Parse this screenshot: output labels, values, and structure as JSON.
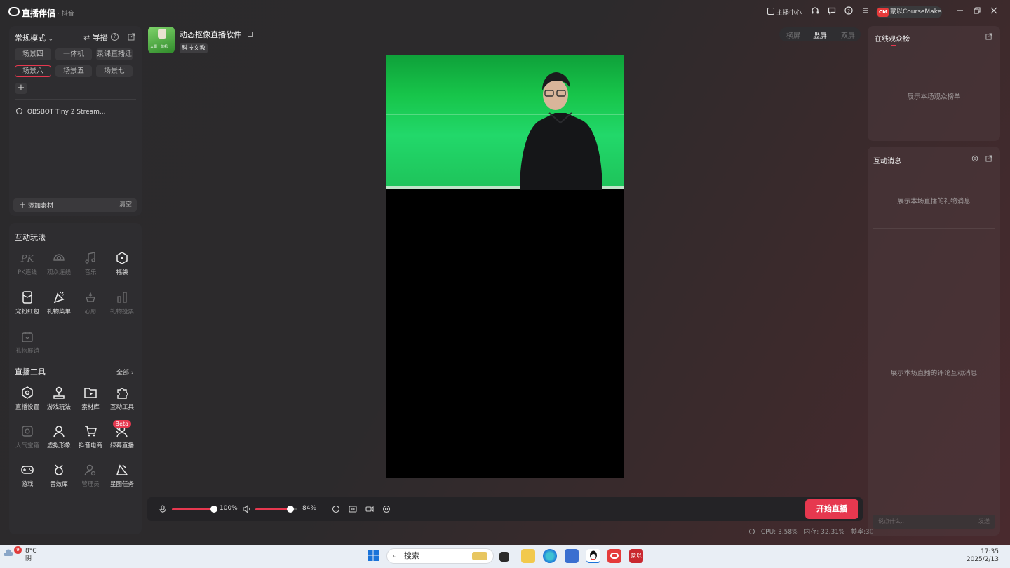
{
  "titlebar": {
    "app_name": "直播伴侣",
    "app_sub": "· 抖音",
    "host_center": "主播中心",
    "user_initials": "CM",
    "user_name": "蒙以CourseMaker"
  },
  "scenes_panel": {
    "mode": "常规模式",
    "guide": "导播",
    "scenes": [
      {
        "label": "场景四",
        "active": false
      },
      {
        "label": "一体机",
        "active": false
      },
      {
        "label": "录课直播迁",
        "active": false
      },
      {
        "label": "场景六",
        "active": true
      },
      {
        "label": "场景五",
        "active": false
      },
      {
        "label": "场景七",
        "active": false
      }
    ],
    "add_scene": "+",
    "source": "OBSBOT Tiny 2 Stream...",
    "add_material": "添加素材",
    "clear": "清空"
  },
  "interactive": {
    "title": "互动玩法",
    "items": [
      {
        "label": "PK连线",
        "icon": "pk-icon",
        "enabled": false
      },
      {
        "label": "观众连线",
        "icon": "audience-link-icon",
        "enabled": false
      },
      {
        "label": "音乐",
        "icon": "music-icon",
        "enabled": false
      },
      {
        "label": "福袋",
        "icon": "lucky-bag-icon",
        "enabled": true
      },
      {
        "label": "宠粉红包",
        "icon": "red-packet-icon",
        "enabled": true
      },
      {
        "label": "礼物菜单",
        "icon": "gift-menu-icon",
        "enabled": true
      },
      {
        "label": "心愿",
        "icon": "wish-icon",
        "enabled": false
      },
      {
        "label": "礼物投票",
        "icon": "gift-vote-icon",
        "enabled": false
      },
      {
        "label": "礼物展馆",
        "icon": "gift-gallery-icon",
        "enabled": false
      }
    ]
  },
  "tools": {
    "title": "直播工具",
    "all": "全部",
    "items": [
      {
        "label": "直播设置",
        "icon": "live-settings-icon",
        "enabled": true
      },
      {
        "label": "游戏玩法",
        "icon": "game-play-icon",
        "enabled": true
      },
      {
        "label": "素材库",
        "icon": "material-library-icon",
        "enabled": true
      },
      {
        "label": "互动工具",
        "icon": "puzzle-icon",
        "enabled": true
      },
      {
        "label": "人气宝箱",
        "icon": "treasure-box-icon",
        "enabled": false
      },
      {
        "label": "虚拟形象",
        "icon": "avatar-icon",
        "enabled": true
      },
      {
        "label": "抖音电商",
        "icon": "cart-icon",
        "enabled": true
      },
      {
        "label": "绿幕直播",
        "icon": "green-screen-icon",
        "enabled": true,
        "badge": "Beta"
      },
      {
        "label": "游戏",
        "icon": "gamepad-icon",
        "enabled": true
      },
      {
        "label": "音效库",
        "icon": "sound-effect-icon",
        "enabled": true
      },
      {
        "label": "管理员",
        "icon": "admin-icon",
        "enabled": false
      },
      {
        "label": "星图任务",
        "icon": "star-task-icon",
        "enabled": true
      }
    ]
  },
  "room": {
    "title": "动态抠像直播软件",
    "tag": "科技文教",
    "thumb_text": "大疆一体机"
  },
  "orientation": {
    "options": [
      "横屏",
      "竖屏",
      "双屏"
    ],
    "selected": "竖屏"
  },
  "controls": {
    "mic_volume_pct": 100,
    "mic_label": "100%",
    "speaker_volume_pct": 84,
    "speaker_label": "84%",
    "go_live": "开始直播"
  },
  "stats": {
    "cpu": "CPU: 3.58%",
    "memory": "内存: 32.31%",
    "fps": "帧率:30"
  },
  "audience_panel": {
    "title": "在线观众榜",
    "empty": "展示本场观众榜单"
  },
  "messages_panel": {
    "title": "互动消息",
    "gift_empty": "展示本场直播的礼物消息",
    "comment_empty": "展示本场直播的评论互动消息",
    "input_placeholder": "说点什么...",
    "send": "发送"
  },
  "taskbar": {
    "weather_badge": "9",
    "temp": "8°C",
    "condition": "阴",
    "search_placeholder": "搜索",
    "time": "17:35",
    "date": "2025/2/13",
    "app_label": "蒙以"
  },
  "colors": {
    "accent": "#e6384f",
    "bg": "#2b2a2c",
    "panel": "#2e2d30",
    "green_screen": "#1ec35a"
  }
}
